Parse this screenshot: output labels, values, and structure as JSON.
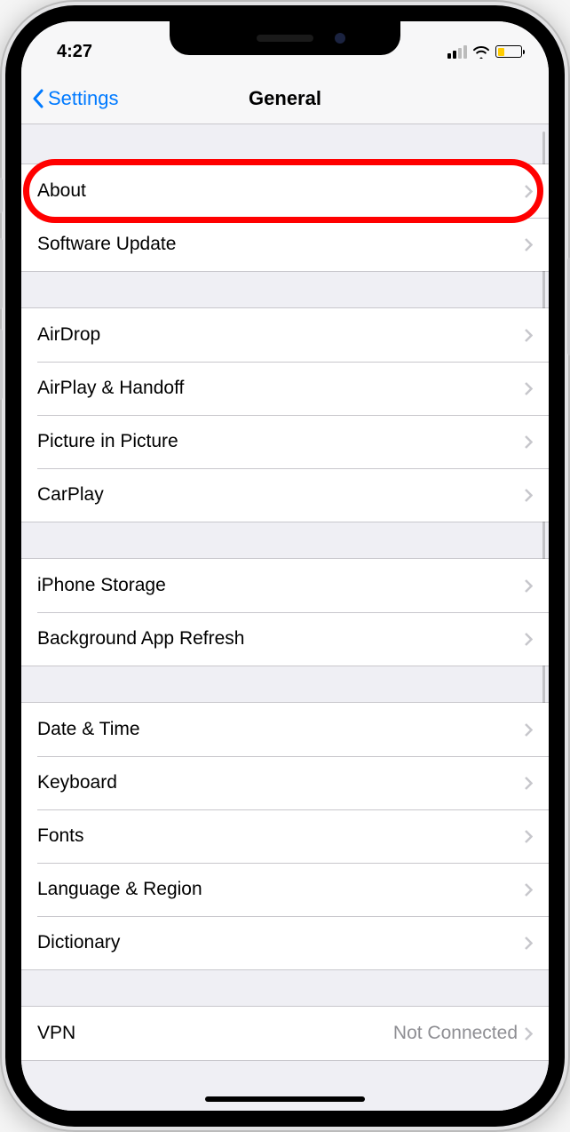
{
  "status": {
    "time": "4:27"
  },
  "nav": {
    "back_label": "Settings",
    "title": "General"
  },
  "groups": [
    {
      "rows": [
        {
          "label": "About",
          "key": "about",
          "highlight": true
        },
        {
          "label": "Software Update",
          "key": "software-update"
        }
      ]
    },
    {
      "rows": [
        {
          "label": "AirDrop",
          "key": "airdrop"
        },
        {
          "label": "AirPlay & Handoff",
          "key": "airplay-handoff"
        },
        {
          "label": "Picture in Picture",
          "key": "picture-in-picture"
        },
        {
          "label": "CarPlay",
          "key": "carplay"
        }
      ]
    },
    {
      "rows": [
        {
          "label": "iPhone Storage",
          "key": "iphone-storage"
        },
        {
          "label": "Background App Refresh",
          "key": "background-app-refresh"
        }
      ]
    },
    {
      "rows": [
        {
          "label": "Date & Time",
          "key": "date-time"
        },
        {
          "label": "Keyboard",
          "key": "keyboard"
        },
        {
          "label": "Fonts",
          "key": "fonts"
        },
        {
          "label": "Language & Region",
          "key": "language-region"
        },
        {
          "label": "Dictionary",
          "key": "dictionary"
        }
      ]
    },
    {
      "rows": [
        {
          "label": "VPN",
          "key": "vpn",
          "value": "Not Connected"
        }
      ]
    }
  ]
}
